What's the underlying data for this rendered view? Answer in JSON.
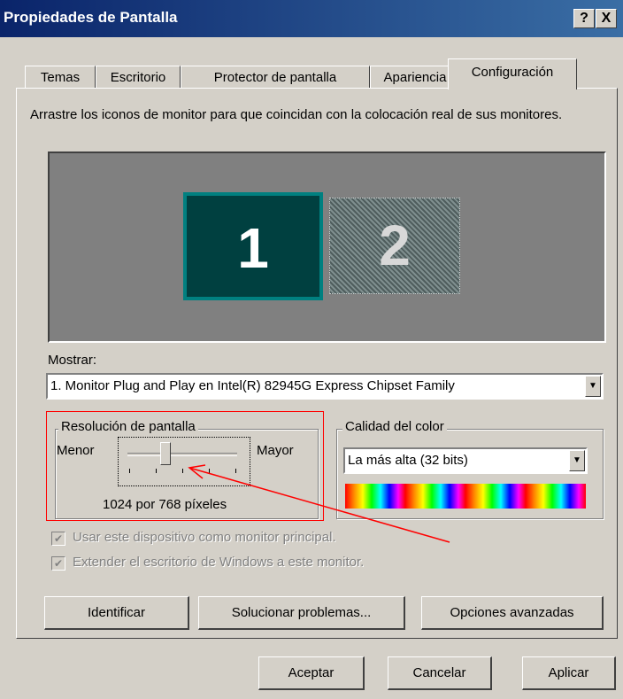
{
  "window": {
    "title": "Propiedades de Pantalla",
    "help_label": "?",
    "close_label": "X"
  },
  "tabs": [
    {
      "label": "Temas",
      "active": false
    },
    {
      "label": "Escritorio",
      "active": false
    },
    {
      "label": "Protector de pantalla",
      "active": false
    },
    {
      "label": "Apariencia",
      "active": false
    },
    {
      "label": "Configuración",
      "active": true
    }
  ],
  "description": "Arrastre los iconos de monitor para que coincidan con la colocación real de sus monitores.",
  "monitors": [
    {
      "label": "1",
      "selected": true
    },
    {
      "label": "2",
      "selected": false
    }
  ],
  "display": {
    "label": "Mostrar:",
    "selected": "1. Monitor Plug and Play en Intel(R) 82945G Express Chipset Family"
  },
  "resolution": {
    "group_label": "Resolución de pantalla",
    "min_label": "Menor",
    "max_label": "Mayor",
    "value_text": "1024 por 768 píxeles",
    "slider_level": 0.33,
    "tick_count": 5
  },
  "color_quality": {
    "group_label": "Calidad del color",
    "selected": "La más alta (32 bits)"
  },
  "checkboxes": [
    {
      "label": "Usar este dispositivo como monitor principal.",
      "checked": true
    },
    {
      "label": "Extender el escritorio de Windows a este monitor.",
      "checked": true
    }
  ],
  "buttons": {
    "identify": "Identificar",
    "troubleshoot": "Solucionar problemas...",
    "advanced": "Opciones avanzadas",
    "ok": "Aceptar",
    "cancel": "Cancelar",
    "apply": "Aplicar"
  },
  "colors": {
    "titlebar": "#0a246a",
    "face": "#d4d0c8",
    "monitor_selected": "#004040",
    "monitor_border": "#008080",
    "annotation": "#ff0000"
  },
  "icons": {
    "check": "check-mark",
    "combo_arrow": "chevron-down-icon"
  }
}
